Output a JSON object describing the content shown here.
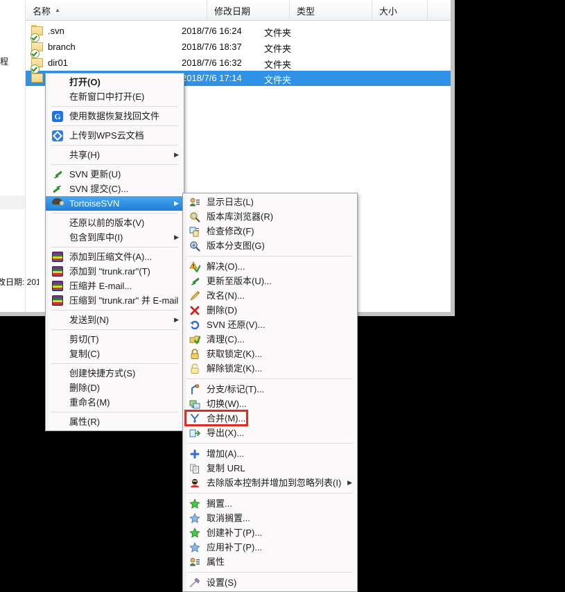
{
  "explorer": {
    "columns": [
      {
        "id": "name",
        "label": "名称",
        "sorted": true,
        "sort_glyph": "▲"
      },
      {
        "id": "date",
        "label": "修改日期"
      },
      {
        "id": "type",
        "label": "类型"
      },
      {
        "id": "size",
        "label": "大小"
      },
      {
        "id": "blank",
        "label": ""
      }
    ],
    "rows": [
      {
        "name": ".svn",
        "date": "2018/7/6 16:24",
        "type": "文件夹",
        "icon": "folder-icon",
        "selected": false
      },
      {
        "name": "branch",
        "date": "2018/7/6 18:37",
        "type": "文件夹",
        "icon": "folder-versioned-icon",
        "selected": false
      },
      {
        "name": "dir01",
        "date": "2018/7/6 16:32",
        "type": "文件夹",
        "icon": "folder-versioned-icon",
        "selected": false
      },
      {
        "name": "",
        "date": "2018/7/6 17:14",
        "type": "文件夹",
        "icon": "folder-versioned-icon",
        "selected": true
      }
    ],
    "left_pane": {
      "clipped_label_top": "程",
      "clipped_label_bottom": "改日期: 201"
    },
    "selection_color": "#2f92e7"
  },
  "context_menu": {
    "items": [
      {
        "label": "打开(O)",
        "icon": "none",
        "bold": true,
        "type": "item"
      },
      {
        "label": "在新窗口中打开(E)",
        "icon": "none",
        "type": "item"
      },
      {
        "type": "separator"
      },
      {
        "label": "使用数据恢复找回文件",
        "icon": "g-recovery-icon",
        "type": "item"
      },
      {
        "type": "separator"
      },
      {
        "label": "上传到WPS云文档",
        "icon": "wps-cloud-icon",
        "type": "item"
      },
      {
        "type": "separator"
      },
      {
        "label": "共享(H)",
        "icon": "none",
        "type": "item",
        "submenu": true
      },
      {
        "type": "separator"
      },
      {
        "label": "SVN 更新(U)",
        "icon": "svn-update-icon",
        "type": "item"
      },
      {
        "label": "SVN 提交(C)...",
        "icon": "svn-commit-icon",
        "type": "item"
      },
      {
        "label": "TortoiseSVN",
        "icon": "tortoise-icon",
        "type": "item",
        "submenu": true,
        "highlighted": true
      },
      {
        "type": "separator"
      },
      {
        "label": "还原以前的版本(V)",
        "icon": "none",
        "type": "item"
      },
      {
        "label": "包含到库中(I)",
        "icon": "none",
        "type": "item",
        "submenu": true
      },
      {
        "type": "separator"
      },
      {
        "label": "添加到压缩文件(A)...",
        "icon": "winrar-icon",
        "type": "item"
      },
      {
        "label": "添加到 \"trunk.rar\"(T)",
        "icon": "winrar-icon",
        "type": "item"
      },
      {
        "label": "压缩并 E-mail...",
        "icon": "winrar-icon",
        "type": "item"
      },
      {
        "label": "压缩到 \"trunk.rar\" 并 E-mail",
        "icon": "winrar-icon",
        "type": "item"
      },
      {
        "type": "separator"
      },
      {
        "label": "发送到(N)",
        "icon": "none",
        "type": "item",
        "submenu": true
      },
      {
        "type": "separator"
      },
      {
        "label": "剪切(T)",
        "icon": "none",
        "type": "item"
      },
      {
        "label": "复制(C)",
        "icon": "none",
        "type": "item"
      },
      {
        "type": "separator"
      },
      {
        "label": "创建快捷方式(S)",
        "icon": "none",
        "type": "item"
      },
      {
        "label": "删除(D)",
        "icon": "none",
        "type": "item"
      },
      {
        "label": "重命名(M)",
        "icon": "none",
        "type": "item"
      },
      {
        "type": "separator"
      },
      {
        "label": "属性(R)",
        "icon": "none",
        "type": "item"
      }
    ]
  },
  "tortoise_submenu": {
    "items": [
      {
        "label": "显示日志(L)",
        "icon": "show-log-icon",
        "type": "item"
      },
      {
        "label": "版本库浏览器(R)",
        "icon": "repo-browser-icon",
        "type": "item"
      },
      {
        "label": "检查修改(F)",
        "icon": "check-modify-icon",
        "type": "item"
      },
      {
        "label": "版本分支图(G)",
        "icon": "revision-graph-icon",
        "type": "item"
      },
      {
        "type": "separator"
      },
      {
        "label": "解决(O)...",
        "icon": "resolve-icon",
        "type": "item"
      },
      {
        "label": "更新至版本(U)...",
        "icon": "update-to-rev-icon",
        "type": "item"
      },
      {
        "label": "改名(N)...",
        "icon": "rename-icon",
        "type": "item"
      },
      {
        "label": "删除(D)",
        "icon": "delete-icon",
        "type": "item"
      },
      {
        "label": "SVN 还原(V)...",
        "icon": "revert-icon",
        "type": "item"
      },
      {
        "label": "清理(C)...",
        "icon": "cleanup-icon",
        "type": "item"
      },
      {
        "label": "获取锁定(K)...",
        "icon": "lock-icon",
        "type": "item"
      },
      {
        "label": "解除锁定(K)...",
        "icon": "unlock-icon",
        "type": "item"
      },
      {
        "type": "separator"
      },
      {
        "label": "分支/标记(T)...",
        "icon": "branch-tag-icon",
        "type": "item"
      },
      {
        "label": "切换(W)...",
        "icon": "switch-icon",
        "type": "item"
      },
      {
        "label": "合并(M)...",
        "icon": "merge-icon",
        "type": "item",
        "annotated": true
      },
      {
        "label": "导出(X)...",
        "icon": "export-icon",
        "type": "item"
      },
      {
        "type": "separator"
      },
      {
        "label": "增加(A)...",
        "icon": "add-icon",
        "type": "item"
      },
      {
        "label": "复制 URL",
        "icon": "copy-url-icon",
        "type": "item"
      },
      {
        "label": "去除版本控制并增加到忽略列表(I)",
        "icon": "unversion-ignore-icon",
        "type": "item",
        "submenu": true
      },
      {
        "type": "separator"
      },
      {
        "label": "搁置...",
        "icon": "shelve-icon",
        "type": "item"
      },
      {
        "label": "取消搁置...",
        "icon": "unshelve-icon",
        "type": "item"
      },
      {
        "label": "创建补丁(P)...",
        "icon": "create-patch-icon",
        "type": "item"
      },
      {
        "label": "应用补丁(P)...",
        "icon": "apply-patch-icon",
        "type": "item"
      },
      {
        "label": "属性",
        "icon": "properties-icon",
        "type": "item"
      },
      {
        "type": "separator"
      },
      {
        "label": "设置(S)",
        "icon": "settings-icon",
        "type": "item"
      }
    ],
    "annotation_color": "#e02b23"
  }
}
